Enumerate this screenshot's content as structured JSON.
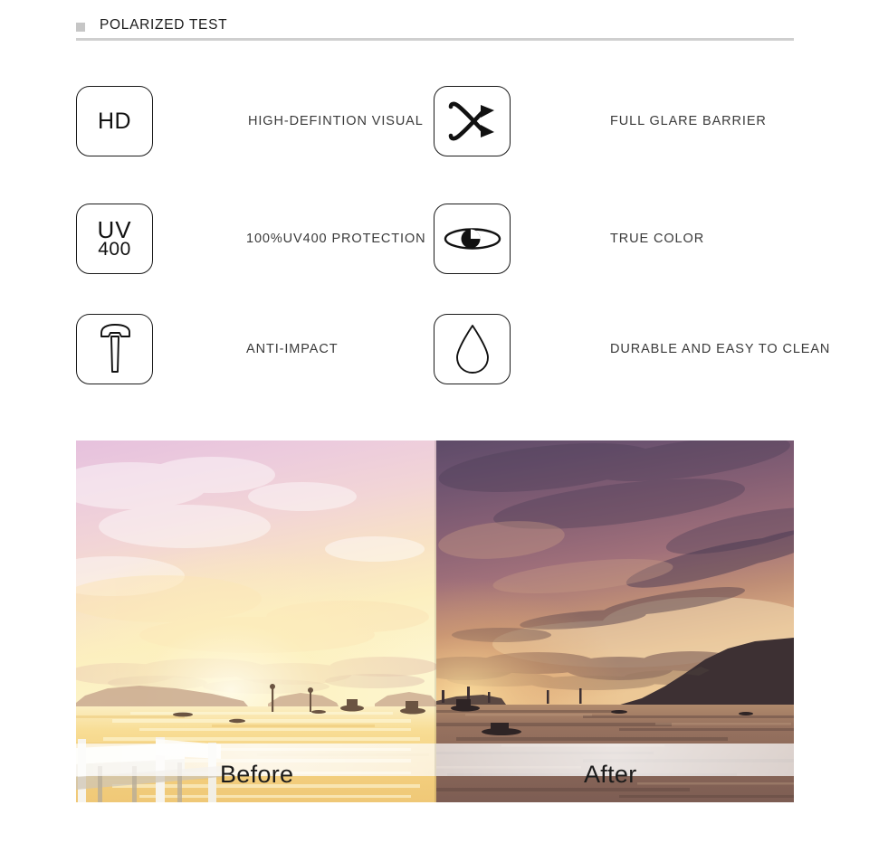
{
  "header": {
    "title": "POLARIZED TEST",
    "bullet_color": "#c6c6c6",
    "rule_color": "#cfcfcf"
  },
  "features": [
    {
      "icon": "hd-icon",
      "icon_text": "HD",
      "label": "HIGH-DEFINTION VISUAL",
      "column": "left",
      "row": 1
    },
    {
      "icon": "crossed-arrows-icon",
      "icon_text": "",
      "label": "FULL GLARE BARRIER",
      "column": "right",
      "row": 1
    },
    {
      "icon": "uv400-icon",
      "icon_text_line1": "UV",
      "icon_text_line2": "400",
      "label": "100%UV400 PROTECTION",
      "column": "left",
      "row": 2
    },
    {
      "icon": "eye-icon",
      "icon_text": "",
      "label": "TRUE COLOR",
      "column": "right",
      "row": 2
    },
    {
      "icon": "hammer-icon",
      "icon_text": "",
      "label": "ANTI-IMPACT",
      "column": "left",
      "row": 3
    },
    {
      "icon": "water-drop-icon",
      "icon_text": "",
      "label": "DURABLE AND EASY TO CLEAN",
      "column": "right",
      "row": 3
    }
  ],
  "comparison": {
    "before_caption": "Before",
    "after_caption": "After",
    "split_x_ratio": 0.502,
    "before_palette": {
      "sky_top": "#e9c6de",
      "sky_mid": "#f3d5d8",
      "sky_low": "#fbe6b8",
      "glow": "#fdf3cf",
      "water": "#f6d98a",
      "land": "#d9b58e",
      "dock": "#ffffff"
    },
    "after_palette": {
      "sky_top": "#6f5570",
      "sky_mid": "#8a6271",
      "sky_low": "#d8a474",
      "glow": "#f0d5ae",
      "water": "#8a6a5c",
      "land": "#4a3a3a",
      "headland": "#3d3033"
    }
  }
}
